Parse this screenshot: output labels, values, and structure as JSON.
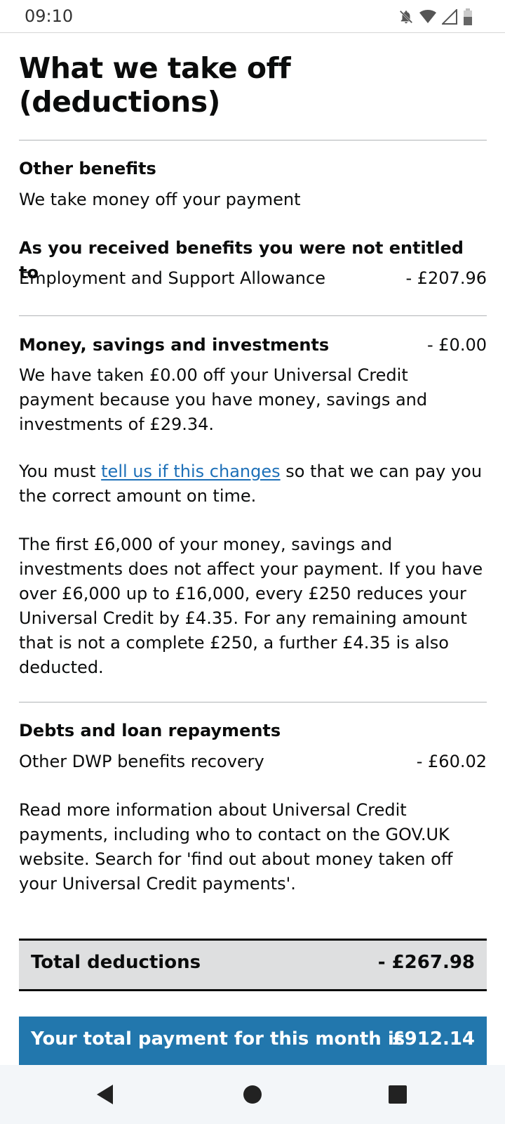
{
  "status_bar": {
    "time": "09:10",
    "icons": [
      "notifications-off-icon",
      "wifi-icon",
      "signal-icon",
      "battery-icon"
    ]
  },
  "page": {
    "title": "What we take off (deductions)"
  },
  "other_benefits": {
    "heading": "Other benefits",
    "subtitle": "We take money off your payment",
    "sub_heading": "As you received benefits you were not entitled to",
    "item_label": "Employment and Support Allowance",
    "item_amount": "- £207.96"
  },
  "money_savings": {
    "heading": "Money, savings and investments",
    "amount": "- £0.00",
    "para1": "We have taken £0.00 off your Universal Credit payment because you have money, savings and investments of £29.34.",
    "para2_before": "You must ",
    "para2_link": "tell us if this changes",
    "para2_after": " so that we can pay you the correct amount on time.",
    "para3": "The first £6,000 of your money, savings and investments does not affect your payment. If you have over £6,000 up to £16,000, every £250 reduces your Universal Credit by £4.35. For any remaining amount that is not a complete £250, a further £4.35 is also deducted."
  },
  "debts": {
    "heading": "Debts and loan repayments",
    "item_label": "Other DWP benefits recovery",
    "item_amount": "- £60.02",
    "info": "Read more information about Universal Credit payments, including who to contact on the GOV.UK website. Search for 'find out about money taken off your Universal Credit payments'."
  },
  "totals": {
    "deductions_label": "Total deductions",
    "deductions_value": "- £267.98",
    "payment_label": "Your total payment for this month is",
    "payment_value": "£912.14"
  },
  "colors": {
    "link": "#1d70b8",
    "payment_banner": "#2277ad",
    "total_box": "#dedfe0"
  },
  "nav_bar": {
    "buttons": [
      "back-icon",
      "home-icon",
      "recents-icon"
    ]
  }
}
